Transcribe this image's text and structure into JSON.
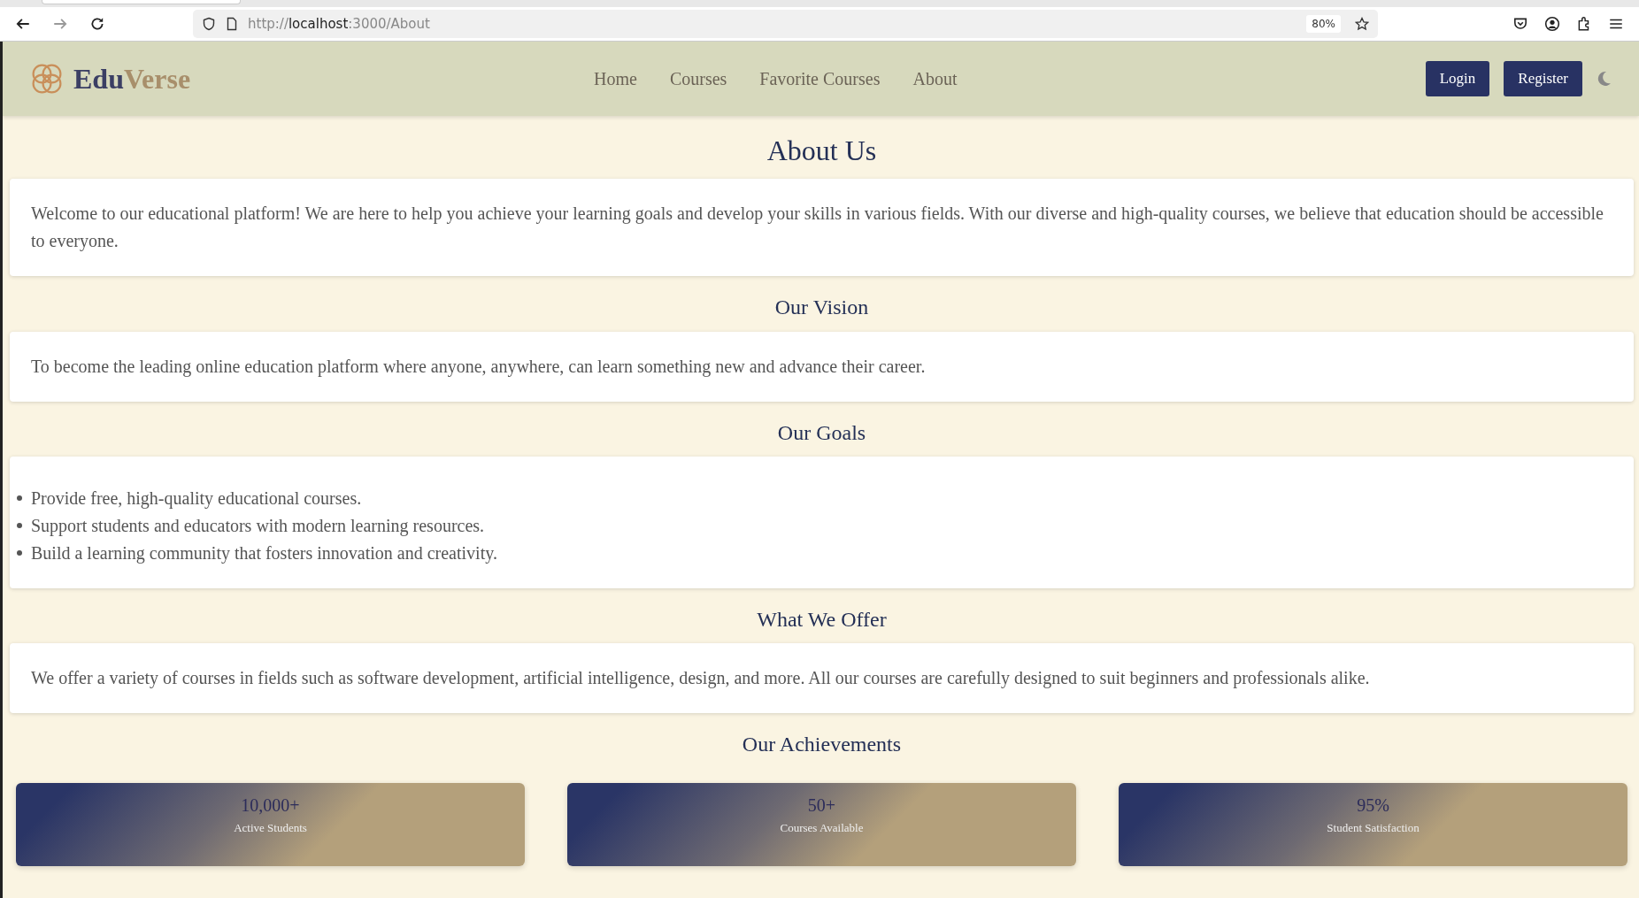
{
  "browser": {
    "url_prefix": "http://",
    "url_host": "localhost",
    "url_rest": ":3000/About",
    "zoom": "80%"
  },
  "brand": {
    "part_1": "Edu",
    "part_2": "Verse"
  },
  "nav": [
    {
      "label": "Home"
    },
    {
      "label": "Courses"
    },
    {
      "label": "Favorite Courses"
    },
    {
      "label": "About"
    }
  ],
  "auth_buttons": [
    {
      "label": "Login"
    },
    {
      "label": "Register"
    }
  ],
  "page_title": "About Us",
  "sections": [
    {
      "kind": "paragraph",
      "text": "Welcome to our educational platform! We are here to help you achieve your learning goals and develop your skills in various fields. With our diverse and high-quality courses, we believe that education should be accessible to everyone."
    },
    {
      "kind": "paragraph",
      "heading": "Our Vision",
      "text": "To become the leading online education platform where anyone, anywhere, can learn something new and advance their career."
    },
    {
      "kind": "list",
      "heading": "Our Goals",
      "items": [
        "Provide free, high-quality educational courses.",
        "Support students and educators with modern learning resources.",
        "Build a learning community that fosters innovation and creativity."
      ]
    },
    {
      "kind": "paragraph",
      "heading": "What We Offer",
      "text": "We offer a variety of courses in fields such as software development, artificial intelligence, design, and more. All our courses are carefully designed to suit beginners and professionals alike."
    }
  ],
  "achievements": {
    "heading": "Our Achievements",
    "stats": [
      {
        "value": "10,000+",
        "label": "Active Students"
      },
      {
        "value": "50+",
        "label": "Courses Available"
      },
      {
        "value": "95%",
        "label": "Student Satisfaction"
      }
    ]
  }
}
